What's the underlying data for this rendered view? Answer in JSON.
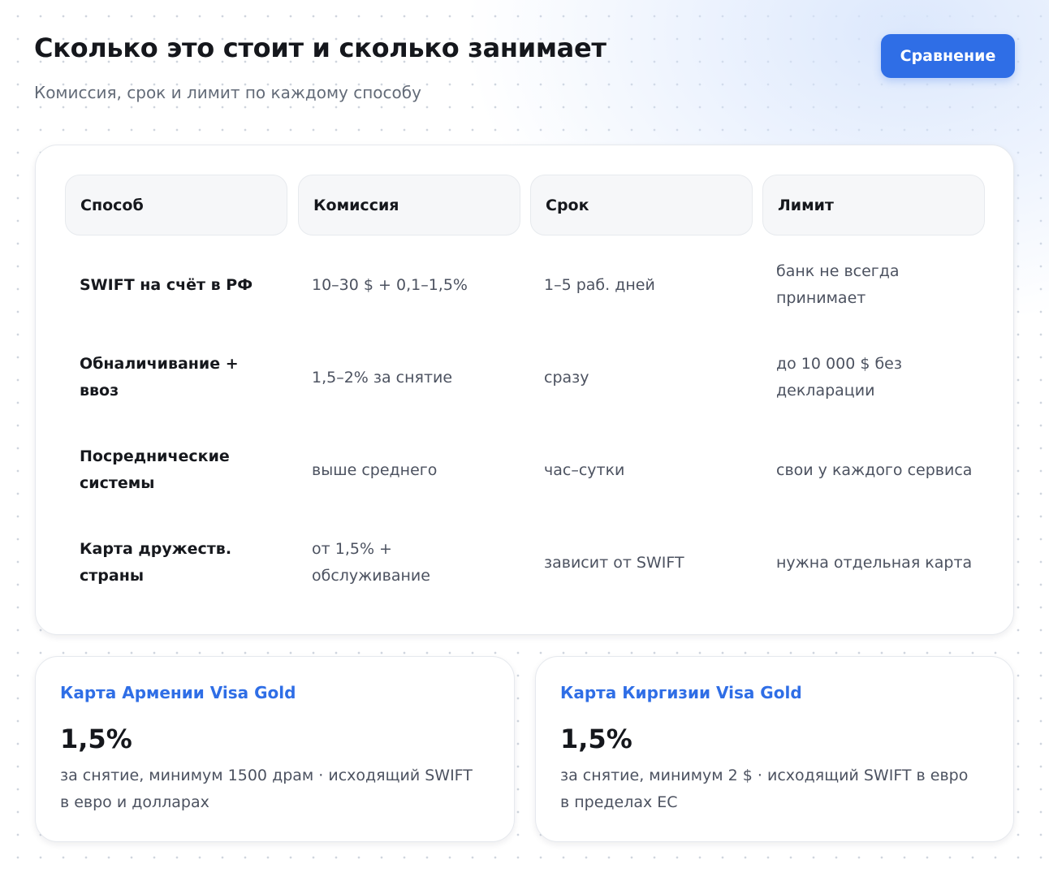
{
  "header": {
    "title": "Сколько это стоит и сколько занимает",
    "subtitle": "Комиссия, срок и лимит по каждому способу",
    "compare_button": "Сравнение"
  },
  "table": {
    "columns": [
      "Способ",
      "Комиссия",
      "Срок",
      "Лимит"
    ],
    "rows": [
      {
        "method": "SWIFT на счёт в РФ",
        "fee": "10–30 $ + 0,1–1,5%",
        "term": "1–5 раб. дней",
        "limit": "банк не всегда принимает"
      },
      {
        "method": "Обналичивание + ввоз",
        "fee": "1,5–2% за снятие",
        "term": "сразу",
        "limit": "до 10 000 $ без декларации"
      },
      {
        "method": "Посреднические системы",
        "fee": "выше среднего",
        "term": "час–сутки",
        "limit": "свои у каждого сервиса"
      },
      {
        "method": "Карта дружеств. страны",
        "fee": "от 1,5% + обслуживание",
        "term": "зависит от SWIFT",
        "limit": "нужна отдельная карта"
      }
    ]
  },
  "cards": [
    {
      "title": "Карта Армении Visa Gold",
      "value": "1,5%",
      "description": "за снятие, минимум 1500 драм · исходящий SWIFT в евро и долларах"
    },
    {
      "title": "Карта Киргизии Visa Gold",
      "value": "1,5%",
      "description": "за снятие, минимум 2 $ · исходящий SWIFT в евро в пределах ЕС"
    }
  ],
  "colors": {
    "accent": "#2f6ee6",
    "text_primary": "#16181d",
    "text_secondary": "#4c5260"
  }
}
